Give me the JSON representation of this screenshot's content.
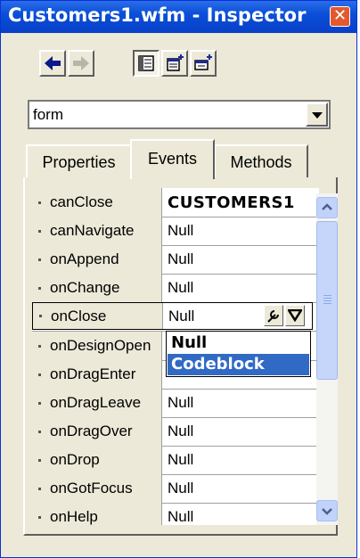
{
  "window": {
    "title": "Customers1.wfm - Inspector",
    "close_glyph": "✕"
  },
  "toolbar": {
    "buttons": [
      {
        "icon": "back-arrow-icon",
        "pressed": false,
        "enabled": true
      },
      {
        "icon": "forward-arrow-icon",
        "pressed": false,
        "enabled": false
      },
      {
        "icon": "categorized-view-icon",
        "pressed": true,
        "enabled": true
      },
      {
        "icon": "new-window-icon",
        "pressed": false,
        "enabled": true
      },
      {
        "icon": "restore-window-icon",
        "pressed": false,
        "enabled": true
      }
    ]
  },
  "object_selector": {
    "value": "form"
  },
  "tabs": [
    {
      "label": "Properties",
      "active": false
    },
    {
      "label": "Events",
      "active": true
    },
    {
      "label": "Methods",
      "active": false
    }
  ],
  "events": [
    {
      "name": "canClose",
      "value": "CUSTOMERS1",
      "bold": true
    },
    {
      "name": "canNavigate",
      "value": "Null"
    },
    {
      "name": "onAppend",
      "value": "Null"
    },
    {
      "name": "onChange",
      "value": "Null"
    },
    {
      "name": "onClose",
      "value": "Null",
      "editing": true
    },
    {
      "name": "onDesignOpen",
      "value": ""
    },
    {
      "name": "onDragEnter",
      "value": ""
    },
    {
      "name": "onDragLeave",
      "value": "Null"
    },
    {
      "name": "onDragOver",
      "value": "Null"
    },
    {
      "name": "onDrop",
      "value": "Null"
    },
    {
      "name": "onGotFocus",
      "value": "Null"
    },
    {
      "name": "onHelp",
      "value": "Null"
    }
  ],
  "value_dropdown": {
    "options": [
      "Null",
      "Codeblock"
    ],
    "selected": "Codeblock"
  },
  "colors": {
    "title_bar": "#0a4fd8",
    "selection": "#316ac5",
    "close_button": "#e2582f"
  }
}
